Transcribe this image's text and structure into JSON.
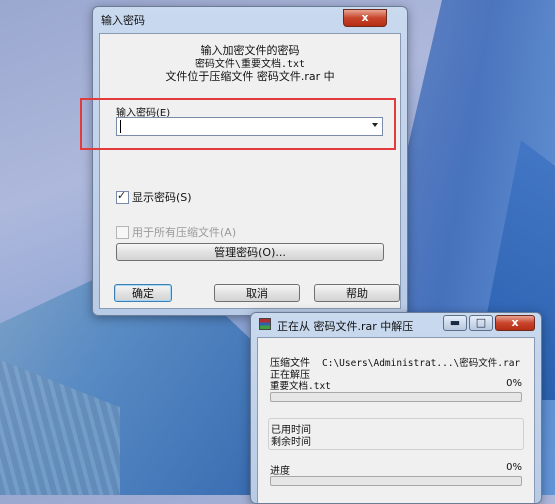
{
  "password_dialog": {
    "title": "输入密码",
    "close_label": "x",
    "info_line1": "输入加密文件的密码",
    "info_line2": "密码文件\\重要文档.txt",
    "info_line3": "文件位于压缩文件 密码文件.rar 中",
    "password_label": "输入密码(E)",
    "password_value": "",
    "show_password_label": "显示密码(S)",
    "show_password_checked": true,
    "use_for_all_label": "用于所有压缩文件(A)",
    "use_for_all_checked": false,
    "manage_button": "管理密码(O)...",
    "ok_button": "确定",
    "cancel_button": "取消",
    "help_button": "帮助"
  },
  "extract_dialog": {
    "title": "正在从 密码文件.rar 中解压",
    "minimize_label": "▬",
    "maximize_label": "□",
    "close_label": "x",
    "archive_label": "压缩文件",
    "archive_path": "C:\\Users\\Administrat...\\密码文件.rar",
    "status": "正在解压",
    "current_file": "重要文档.txt",
    "file_percent": "0%",
    "file_progress": 0,
    "elapsed_label": "已用时间",
    "remaining_label": "剩余时间",
    "progress_label": "进度",
    "total_percent": "0%",
    "total_progress": 0
  },
  "colors": {
    "highlight_box": "#e23b3b",
    "progress_fill": "#37b34a"
  }
}
